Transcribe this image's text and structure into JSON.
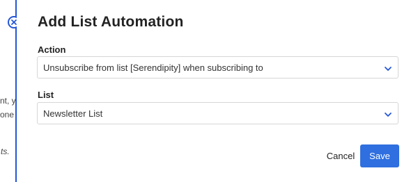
{
  "background": {
    "fragments": [
      "nt, y",
      "one",
      "ts."
    ]
  },
  "dialog": {
    "title": "Add List Automation",
    "close_icon": "close-icon",
    "action": {
      "label": "Action",
      "value": "Unsubscribe from list [Serendipity] when subscribing to"
    },
    "list": {
      "label": "List",
      "value": "Newsletter List"
    },
    "cancel_label": "Cancel",
    "save_label": "Save"
  },
  "colors": {
    "accent": "#2456d6",
    "save_button": "#2f6fe0"
  }
}
